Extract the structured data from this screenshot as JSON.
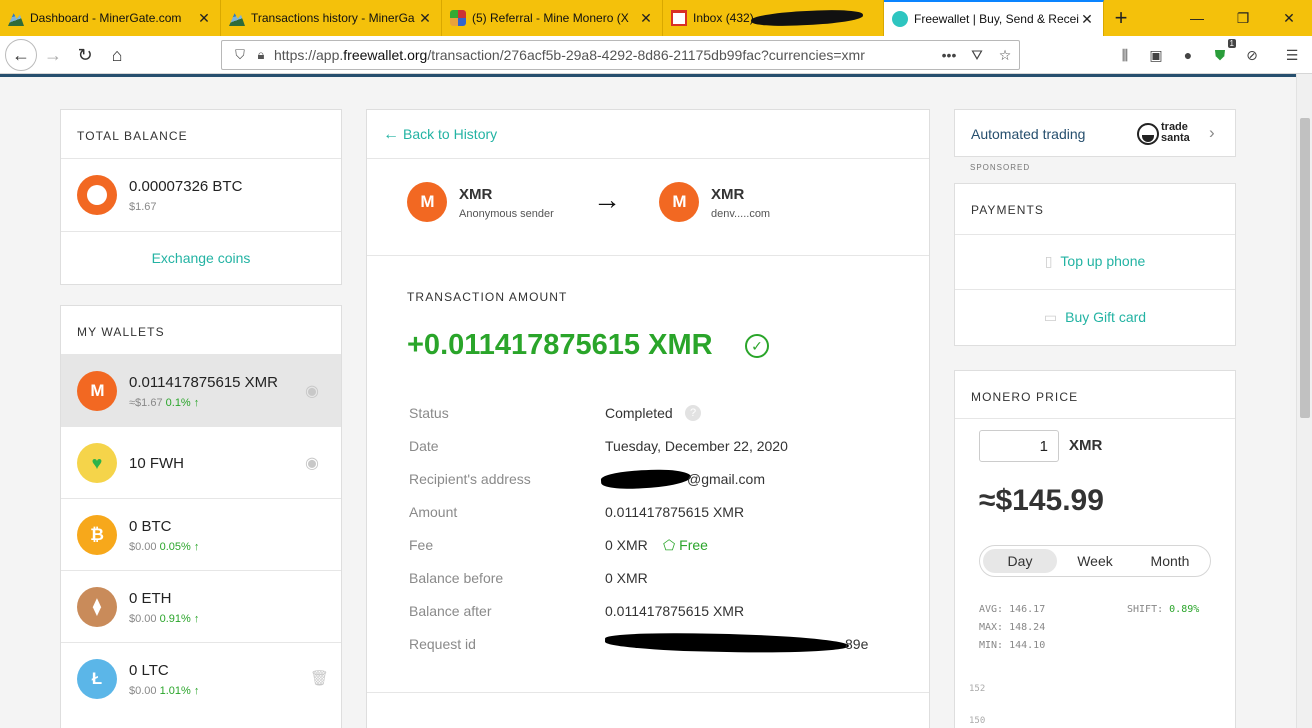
{
  "browser": {
    "tabs": [
      {
        "title": "Dashboard - MinerGate.com",
        "icon": "minergate-icon"
      },
      {
        "title": "Transactions history - MinerGa",
        "icon": "minergate-icon"
      },
      {
        "title": "(5) Referral - Mine Monero (X",
        "icon": "referral-icon"
      },
      {
        "title": "Inbox (432) —",
        "icon": "gmail-icon"
      },
      {
        "title": "Freewallet | Buy, Send & Recei",
        "icon": "freewallet-icon"
      }
    ],
    "url_prefix": "https://app.",
    "url_host": "freewallet.org",
    "url_path": "/transaction/276acf5b-29a8-4292-8d86-21175db99fac?currencies=xmr",
    "badge_count": "1"
  },
  "balance": {
    "caption": "TOTAL BALANCE",
    "amount": "0.00007326 BTC",
    "usd": "$1.67",
    "exchange_label": "Exchange coins"
  },
  "wallets": {
    "caption": "MY WALLETS",
    "items": [
      {
        "amount": "0.011417875615 XMR",
        "usd": "≈$1.67",
        "change": "0.1% ↑"
      },
      {
        "amount": "10 FWH",
        "usd": "",
        "change": ""
      },
      {
        "amount": "0 BTC",
        "usd": "$0.00",
        "change": "0.05% ↑"
      },
      {
        "amount": "0 ETH",
        "usd": "$0.00",
        "change": "0.91% ↑"
      },
      {
        "amount": "0 LTC",
        "usd": "$0.00",
        "change": "1.01% ↑"
      }
    ]
  },
  "transaction": {
    "back_label": "Back to History",
    "from": {
      "coin": "XMR",
      "name": "Anonymous sender"
    },
    "to": {
      "coin": "XMR",
      "name": "denv.....com"
    },
    "amount_caption": "TRANSACTION AMOUNT",
    "amount": "+0.011417875615 XMR",
    "rows": [
      {
        "label": "Status",
        "value": "Completed"
      },
      {
        "label": "Date",
        "value": "Tuesday, December 22, 2020"
      },
      {
        "label": "Recipient's address",
        "value": "@gmail.com"
      },
      {
        "label": "Amount",
        "value": "0.011417875615 XMR"
      },
      {
        "label": "Fee",
        "value": "0 XMR"
      },
      {
        "label": "Balance before",
        "value": "0 XMR"
      },
      {
        "label": "Balance after",
        "value": "0.011417875615 XMR"
      },
      {
        "label": "Request id",
        "value": "89e"
      }
    ],
    "fee_badge": "Free"
  },
  "sidebar": {
    "automated_trading": "Automated trading",
    "tradesanta_line1": "trade",
    "tradesanta_line2": "santa",
    "sponsored": "SPONSORED",
    "payments_caption": "PAYMENTS",
    "top_up": "Top up phone",
    "gift_card": "Buy Gift card"
  },
  "price": {
    "caption": "MONERO PRICE",
    "qty": "1",
    "unit": "XMR",
    "value": "≈$145.99",
    "periods": [
      "Day",
      "Week",
      "Month"
    ],
    "active_period": "Day",
    "avg": "AVG: 146.17",
    "max": "MAX: 148.24",
    "min": "MIN: 144.10",
    "shift_label": "SHIFT:",
    "shift_value": "0.89%",
    "chart_ticks": [
      "152",
      "150"
    ]
  },
  "colors": {
    "accent_teal": "#23b3a3",
    "positive_green": "#2aa52a",
    "monero_orange": "#f26822",
    "tab_bar": "#f4c10b"
  }
}
